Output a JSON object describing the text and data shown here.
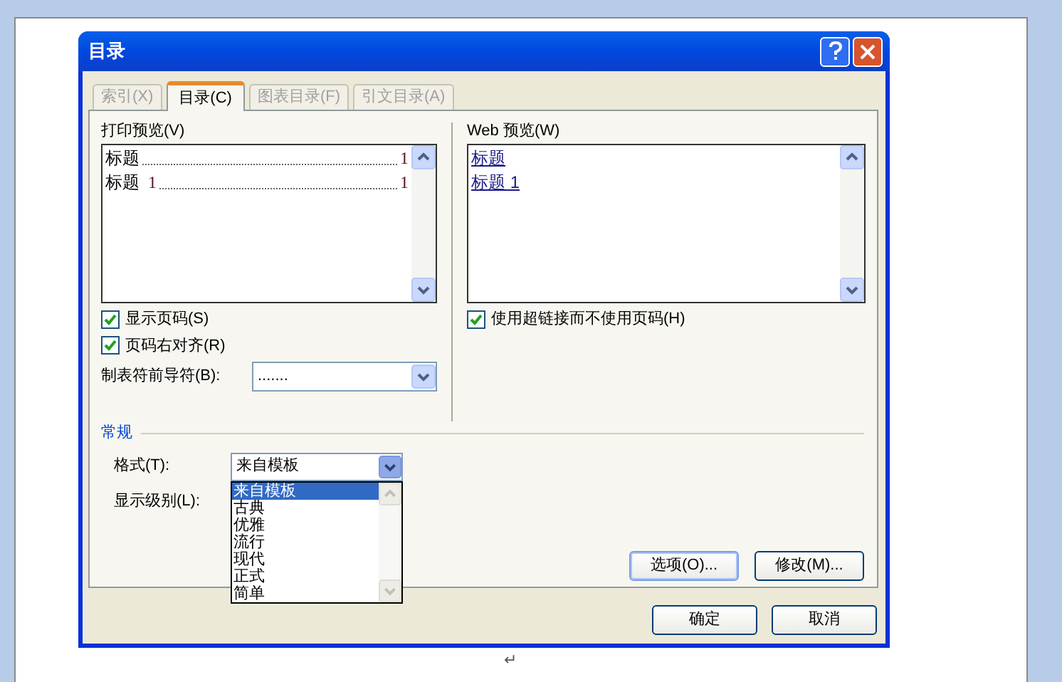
{
  "window": {
    "title": "目录"
  },
  "tabs": [
    {
      "label": "索引(X)",
      "selected": false
    },
    {
      "label": "目录(C)",
      "selected": true
    },
    {
      "label": "图表目录(F)",
      "selected": false
    },
    {
      "label": "引文目录(A)",
      "selected": false
    }
  ],
  "print_preview": {
    "label": "打印预览(V)",
    "entries": [
      {
        "heading": "标题",
        "page": "1"
      },
      {
        "heading": "标题",
        "number": "1",
        "page": "1"
      }
    ]
  },
  "web_preview": {
    "label": "Web 预览(W)",
    "links": [
      "标题",
      "标题 1"
    ]
  },
  "left_options": [
    {
      "label": "显示页码(S)",
      "checked": true
    },
    {
      "label": "页码右对齐(R)",
      "checked": true
    }
  ],
  "tab_leader": {
    "label": "制表符前导符(B):",
    "value": "......."
  },
  "right_options": [
    {
      "label": "使用超链接而不使用页码(H)",
      "checked": true
    }
  ],
  "general": {
    "title": "常规",
    "format": {
      "label": "格式(T):",
      "value": "来自模板",
      "expanded": true,
      "options": [
        {
          "label": "来自模板",
          "selected": true
        },
        {
          "label": "古典",
          "selected": false
        },
        {
          "label": "优雅",
          "selected": false
        },
        {
          "label": "流行",
          "selected": false
        },
        {
          "label": "现代",
          "selected": false
        },
        {
          "label": "正式",
          "selected": false
        },
        {
          "label": "简单",
          "selected": false
        }
      ]
    },
    "show_levels": {
      "label": "显示级别(L):"
    }
  },
  "panel_buttons": [
    "选项(O)...",
    "修改(M)..."
  ],
  "dialog_buttons": [
    "确定",
    "取消"
  ],
  "document": {
    "paragraph_mark": "↵"
  }
}
